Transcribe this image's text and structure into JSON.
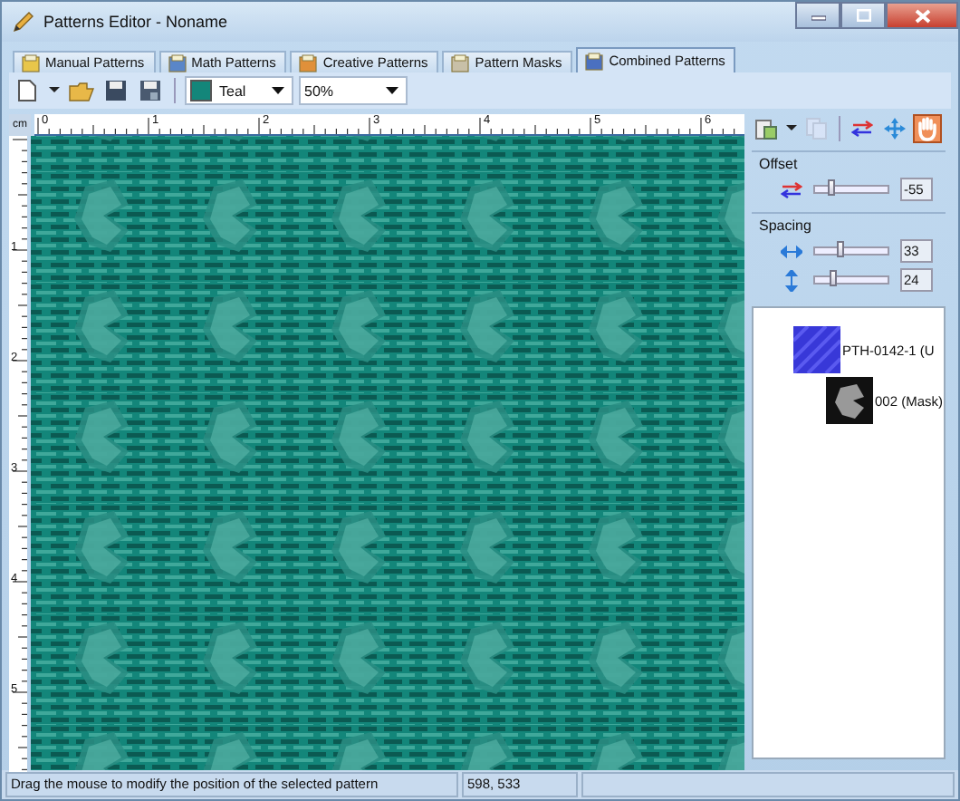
{
  "window": {
    "title": "Patterns Editor - Noname"
  },
  "tabs": [
    {
      "label": "Manual Patterns",
      "selected": false
    },
    {
      "label": "Math Patterns",
      "selected": false
    },
    {
      "label": "Creative Patterns",
      "selected": false
    },
    {
      "label": "Pattern Masks",
      "selected": false
    },
    {
      "label": "Combined Patterns",
      "selected": true
    }
  ],
  "toolbar": {
    "color_name": "Teal",
    "color": "#13867a",
    "zoom": "50%"
  },
  "ruler": {
    "unit": "cm",
    "h_labels": [
      "0",
      "1",
      "2",
      "3",
      "4",
      "5",
      "6"
    ],
    "v_labels": [
      "1",
      "2",
      "3",
      "4",
      "5"
    ]
  },
  "offset": {
    "title": "Offset",
    "value": "-55",
    "level": 0.22
  },
  "spacing": {
    "title": "Spacing",
    "rows": [
      {
        "kind": "horizontal",
        "value": "33",
        "level": 0.36
      },
      {
        "kind": "vertical",
        "value": "24",
        "level": 0.26
      }
    ]
  },
  "tree": [
    {
      "label": "PTH-0142-1 (U",
      "kind": "pattern",
      "children": [
        {
          "label": "002 (Mask)",
          "kind": "mask"
        }
      ]
    }
  ],
  "status_bar": {
    "message": "Drag the mouse to modify the position of the selected pattern",
    "coords": "598, 533"
  }
}
